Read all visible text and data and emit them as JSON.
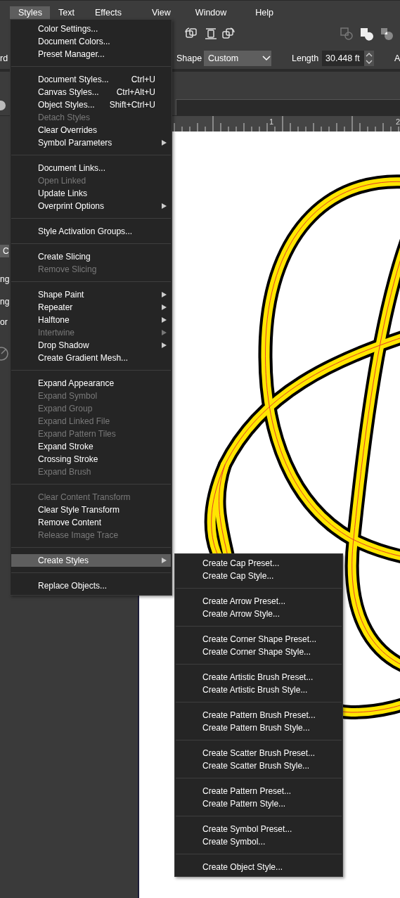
{
  "menubar": [
    {
      "label": "Styles",
      "selected": true
    },
    {
      "label": "Text",
      "selected": false
    },
    {
      "label": "Effects",
      "selected": false
    },
    {
      "label": "View",
      "selected": false
    },
    {
      "label": "Window",
      "selected": false
    },
    {
      "label": "Help",
      "selected": false
    }
  ],
  "toolbar": {
    "row_label": "rd",
    "shape_label": "Shape",
    "shape_value": "Custom",
    "length_label": "Length",
    "length_value": "30.448 ft",
    "edge_label": "A"
  },
  "left_panel": {
    "button_label": "C",
    "fragments": [
      "ng",
      "ng",
      "or"
    ]
  },
  "ruler": {
    "labels": [
      "1",
      "2"
    ]
  },
  "menu": {
    "groups": [
      [
        {
          "label": "Color Settings...",
          "disabled": false,
          "submenu": false,
          "selected": false
        },
        {
          "label": "Document Colors...",
          "disabled": false,
          "submenu": false,
          "selected": false
        },
        {
          "label": "Preset Manager...",
          "disabled": false,
          "submenu": false,
          "selected": false
        }
      ],
      [
        {
          "label": "Document Styles...",
          "shortcut": "Ctrl+U",
          "disabled": false,
          "submenu": false,
          "selected": false
        },
        {
          "label": "Canvas Styles...",
          "shortcut": "Ctrl+Alt+U",
          "disabled": false,
          "submenu": false,
          "selected": false
        },
        {
          "label": "Object Styles...",
          "shortcut": "Shift+Ctrl+U",
          "disabled": false,
          "submenu": false,
          "selected": false
        },
        {
          "label": "Detach Styles",
          "disabled": true,
          "submenu": false,
          "selected": false
        },
        {
          "label": "Clear Overrides",
          "disabled": false,
          "submenu": false,
          "selected": false
        },
        {
          "label": "Symbol Parameters",
          "disabled": false,
          "submenu": true,
          "selected": false
        }
      ],
      [
        {
          "label": "Document Links...",
          "disabled": false,
          "submenu": false,
          "selected": false
        },
        {
          "label": "Open Linked",
          "disabled": true,
          "submenu": false,
          "selected": false
        },
        {
          "label": "Update Links",
          "disabled": false,
          "submenu": false,
          "selected": false
        },
        {
          "label": "Overprint Options",
          "disabled": false,
          "submenu": true,
          "selected": false
        }
      ],
      [
        {
          "label": "Style Activation Groups...",
          "disabled": false,
          "submenu": false,
          "selected": false
        }
      ],
      [
        {
          "label": "Create Slicing",
          "disabled": false,
          "submenu": false,
          "selected": false
        },
        {
          "label": "Remove Slicing",
          "disabled": true,
          "submenu": false,
          "selected": false
        }
      ],
      [
        {
          "label": "Shape Paint",
          "disabled": false,
          "submenu": true,
          "selected": false
        },
        {
          "label": "Repeater",
          "disabled": false,
          "submenu": true,
          "selected": false
        },
        {
          "label": "Halftone",
          "disabled": false,
          "submenu": true,
          "selected": false
        },
        {
          "label": "Intertwine",
          "disabled": true,
          "submenu": true,
          "selected": false
        },
        {
          "label": "Drop Shadow",
          "disabled": false,
          "submenu": true,
          "selected": false
        },
        {
          "label": "Create Gradient Mesh...",
          "disabled": false,
          "submenu": false,
          "selected": false
        }
      ],
      [
        {
          "label": "Expand Appearance",
          "disabled": false,
          "submenu": false,
          "selected": false
        },
        {
          "label": "Expand Symbol",
          "disabled": true,
          "submenu": false,
          "selected": false
        },
        {
          "label": "Expand Group",
          "disabled": true,
          "submenu": false,
          "selected": false
        },
        {
          "label": "Expand Linked File",
          "disabled": true,
          "submenu": false,
          "selected": false
        },
        {
          "label": "Expand Pattern Tiles",
          "disabled": true,
          "submenu": false,
          "selected": false
        },
        {
          "label": "Expand Stroke",
          "disabled": false,
          "submenu": false,
          "selected": false
        },
        {
          "label": "Crossing Stroke",
          "disabled": false,
          "submenu": false,
          "selected": false
        },
        {
          "label": "Expand Brush",
          "disabled": true,
          "submenu": false,
          "selected": false
        }
      ],
      [
        {
          "label": "Clear Content Transform",
          "disabled": true,
          "submenu": false,
          "selected": false
        },
        {
          "label": "Clear Style Transform",
          "disabled": false,
          "submenu": false,
          "selected": false
        },
        {
          "label": "Remove Content",
          "disabled": false,
          "submenu": false,
          "selected": false
        },
        {
          "label": "Release Image Trace",
          "disabled": true,
          "submenu": false,
          "selected": false
        }
      ],
      [
        {
          "label": "Create Styles",
          "disabled": false,
          "submenu": true,
          "selected": true
        }
      ],
      [
        {
          "label": "Replace Objects...",
          "disabled": false,
          "submenu": false,
          "selected": false
        }
      ]
    ]
  },
  "submenu": {
    "groups": [
      [
        {
          "label": "Create Cap Preset...",
          "disabled": false,
          "selected": false
        },
        {
          "label": "Create Cap Style...",
          "disabled": false,
          "selected": false
        }
      ],
      [
        {
          "label": "Create Arrow Preset...",
          "disabled": false,
          "selected": false
        },
        {
          "label": "Create Arrow Style...",
          "disabled": false,
          "selected": false
        }
      ],
      [
        {
          "label": "Create Corner Shape Preset...",
          "disabled": false,
          "selected": false
        },
        {
          "label": "Create Corner Shape Style...",
          "disabled": false,
          "selected": false
        }
      ],
      [
        {
          "label": "Create Artistic Brush Preset...",
          "disabled": false,
          "selected": false
        },
        {
          "label": "Create Artistic Brush Style...",
          "disabled": false,
          "selected": false
        }
      ],
      [
        {
          "label": "Create Pattern Brush Preset...",
          "disabled": false,
          "selected": false
        },
        {
          "label": "Create Pattern Brush Style...",
          "disabled": false,
          "selected": false
        }
      ],
      [
        {
          "label": "Create Scatter Brush Preset...",
          "disabled": false,
          "selected": false
        },
        {
          "label": "Create Scatter Brush Style...",
          "disabled": false,
          "selected": false
        }
      ],
      [
        {
          "label": "Create Pattern Preset...",
          "disabled": false,
          "selected": false
        },
        {
          "label": "Create Pattern Style...",
          "disabled": false,
          "selected": false
        }
      ],
      [
        {
          "label": "Create Symbol Preset...",
          "disabled": false,
          "selected": false
        },
        {
          "label": "Create Symbol...",
          "disabled": false,
          "selected": false
        }
      ],
      [
        {
          "label": "Create Object Style...",
          "disabled": false,
          "selected": false
        }
      ]
    ]
  }
}
